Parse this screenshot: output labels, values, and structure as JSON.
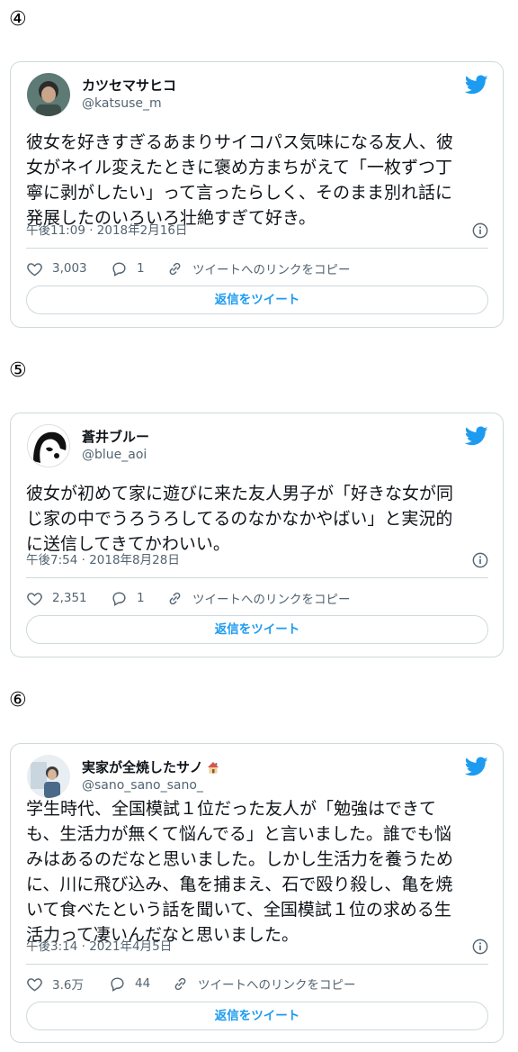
{
  "sections": [
    {
      "number": "④",
      "user": {
        "name": "カツセマサヒコ",
        "handle": "@katsuse_m"
      },
      "text": [
        "彼女を好きすぎるあまりサイコパス気味になる友人、彼",
        "女がネイル変えたときに褒め方まちがえて「一枚ずつ丁",
        "寧に剥がしたい」って言ったらしく、そのまま別れ話に",
        "発展したのいろいろ壮絶すぎて好き。"
      ],
      "timestamp": "午後11:09 · 2018年2月16日",
      "likes": "3,003",
      "replies": "1",
      "copy_link": "ツイートへのリンクをコピー",
      "reply_button": "返信をツイート"
    },
    {
      "number": "⑤",
      "user": {
        "name": "蒼井ブルー",
        "handle": "@blue_aoi"
      },
      "text": [
        "彼女が初めて家に遊びに来た友人男子が「好きな女が同",
        "じ家の中でうろうろしてるのなかなかやばい」と実況的",
        "に送信してきてかわいい。"
      ],
      "timestamp": "午後7:54 · 2018年8月28日",
      "likes": "2,351",
      "replies": "1",
      "copy_link": "ツイートへのリンクをコピー",
      "reply_button": "返信をツイート"
    },
    {
      "number": "⑥",
      "user": {
        "name": "実家が全焼したサノ",
        "handle": "@sano_sano_sano_",
        "badge_icon": "house-emoji-icon"
      },
      "text": [
        "学生時代、全国模試１位だった友人が「勉強はできて",
        "も、生活力が無くて悩んでる」と言いました。誰でも悩",
        "みはあるのだなと思いました。しかし生活力を養うため",
        "に、川に飛び込み、亀を捕まえ、石で殴り殺し、亀を焼",
        "いて食べたという話を聞いて、全国模試１位の求める生",
        "活力って凄いんだなと思いました。"
      ],
      "timestamp": "午後3:14 · 2021年4月5日",
      "likes": "3.6万",
      "replies": "44",
      "copy_link": "ツイートへのリンクをコピー",
      "reply_button": "返信をツイート"
    }
  ],
  "colors": {
    "accent": "#1d9bf0",
    "secondary_text": "#536471",
    "border": "#cfd9de"
  }
}
